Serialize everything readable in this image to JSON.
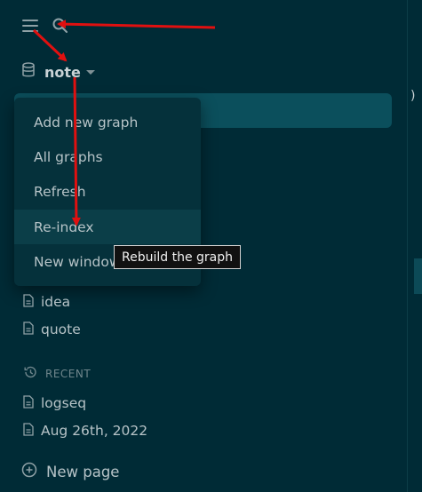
{
  "header": {
    "menu_icon": "hamburger-icon",
    "search_icon": "search-icon"
  },
  "graph": {
    "icon": "database-icon",
    "name": "note",
    "caret_icon": "caret-down-icon"
  },
  "graph_menu": {
    "items": [
      {
        "label": "Add new graph"
      },
      {
        "label": "All graphs"
      },
      {
        "label": "Refresh"
      },
      {
        "label": "Re-index"
      },
      {
        "label": "New window"
      }
    ],
    "highlighted_item": "Re-index"
  },
  "tooltip": {
    "text": "Rebuild the graph"
  },
  "favorites": {
    "items": [
      {
        "label": "idea",
        "icon": "page-icon"
      },
      {
        "label": "quote",
        "icon": "page-icon"
      }
    ]
  },
  "recent": {
    "title": "RECENT",
    "icon": "history-icon",
    "items": [
      {
        "label": "logseq",
        "icon": "page-icon"
      },
      {
        "label": "Aug 26th, 2022",
        "icon": "page-icon"
      }
    ]
  },
  "new_page": {
    "label": "New page",
    "icon": "plus-circle-icon"
  },
  "right_pane": {
    "glyph": ")"
  },
  "colors": {
    "background": "#002b36",
    "menu_background": "#05313b",
    "highlight": "#0b4f5c",
    "annotation_arrow": "#e01010"
  }
}
